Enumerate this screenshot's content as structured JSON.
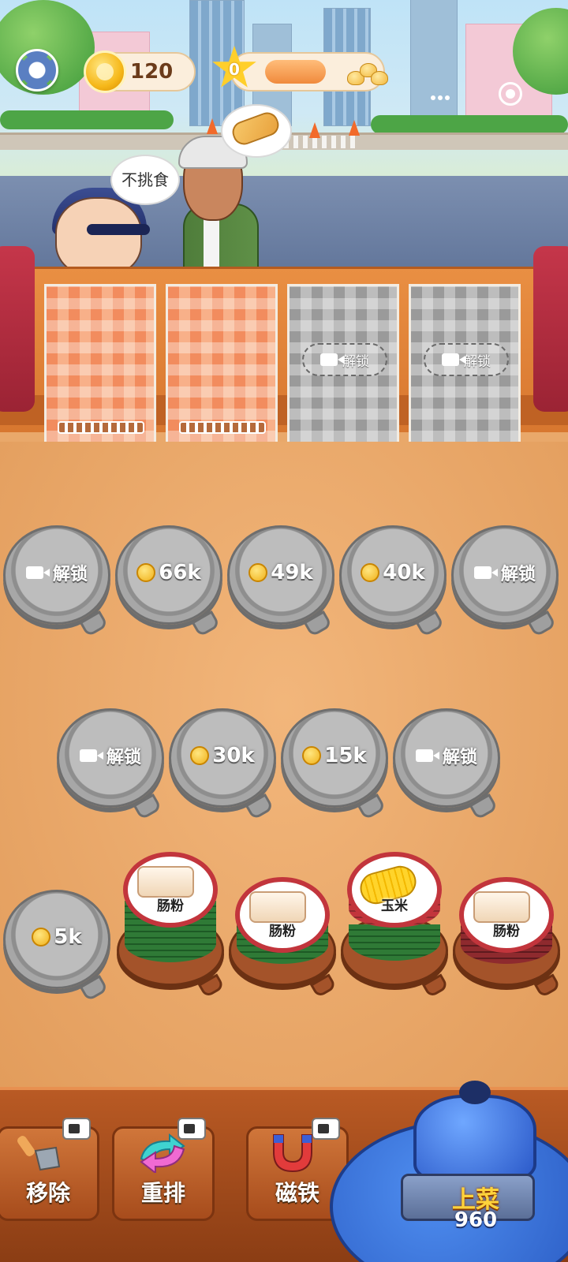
{
  "hud": {
    "coins": "120",
    "stars": "0",
    "star_progress": 0.55
  },
  "customers": [
    {
      "name": "kid",
      "bubble_text": "不挑食"
    },
    {
      "name": "old-man",
      "order_icon": "burrito-wrap-icon"
    }
  ],
  "tables": [
    {
      "state": "open",
      "color": "orange"
    },
    {
      "state": "open",
      "color": "orange"
    },
    {
      "state": "locked",
      "unlock_label": "解锁",
      "icon": "video-icon"
    },
    {
      "state": "locked",
      "unlock_label": "解锁",
      "icon": "video-icon"
    }
  ],
  "plate_rows": {
    "row1": [
      {
        "kind": "video",
        "label": "解锁"
      },
      {
        "kind": "coin",
        "label": "66k"
      },
      {
        "kind": "coin",
        "label": "49k"
      },
      {
        "kind": "coin",
        "label": "40k"
      },
      {
        "kind": "video",
        "label": "解锁"
      }
    ],
    "row2": [
      {
        "kind": "video",
        "label": "解锁"
      },
      {
        "kind": "coin",
        "label": "30k"
      },
      {
        "kind": "coin",
        "label": "15k"
      },
      {
        "kind": "video",
        "label": "解锁"
      }
    ],
    "row3_locked": {
      "kind": "coin",
      "label": "5k"
    }
  },
  "stacks": [
    {
      "food": "肠粉",
      "layers": 7,
      "colors": [
        "#c2353c",
        "#2f7a36"
      ]
    },
    {
      "food": "肠粉",
      "layers": 5,
      "colors": [
        "#c2353c",
        "#2f7a36"
      ]
    },
    {
      "food": "玉米",
      "layers": 8,
      "colors": [
        "#c2353c",
        "#2f7a36"
      ]
    },
    {
      "food": "肠粉",
      "layers": 6,
      "colors": [
        "#8e2a2e",
        "#c2353c"
      ]
    }
  ],
  "tools": [
    {
      "label": "移除",
      "icon": "shovel-icon"
    },
    {
      "label": "重排",
      "icon": "shuffle-arrows-icon"
    },
    {
      "label": "磁铁",
      "icon": "magnet-icon"
    }
  ],
  "serve": {
    "label": "上菜",
    "count": "960"
  },
  "colors": {
    "accent_orange": "#e98f43",
    "coin_gold": "#f6b81a",
    "serve_blue": "#2a58c8"
  }
}
